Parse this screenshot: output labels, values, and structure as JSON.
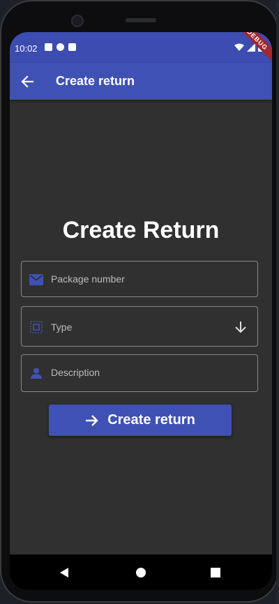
{
  "status_bar": {
    "time": "10:02",
    "debug_label": "DEBUG"
  },
  "app_bar": {
    "title": "Create return",
    "back_icon": "arrow-back-icon"
  },
  "form": {
    "heading": "Create Return",
    "package_number": {
      "placeholder": "Package number",
      "icon": "mail-icon"
    },
    "type": {
      "label": "Type",
      "icon": "select-frame-icon",
      "trailing_icon": "arrow-down-icon"
    },
    "description": {
      "placeholder": "Description",
      "icon": "person-icon"
    },
    "submit": {
      "label": "Create return",
      "icon": "arrow-forward-icon"
    }
  },
  "colors": {
    "primary": "#3f51b5",
    "status_bar": "#3c4cb0",
    "background": "#303030",
    "debug_banner": "#a0282f"
  }
}
